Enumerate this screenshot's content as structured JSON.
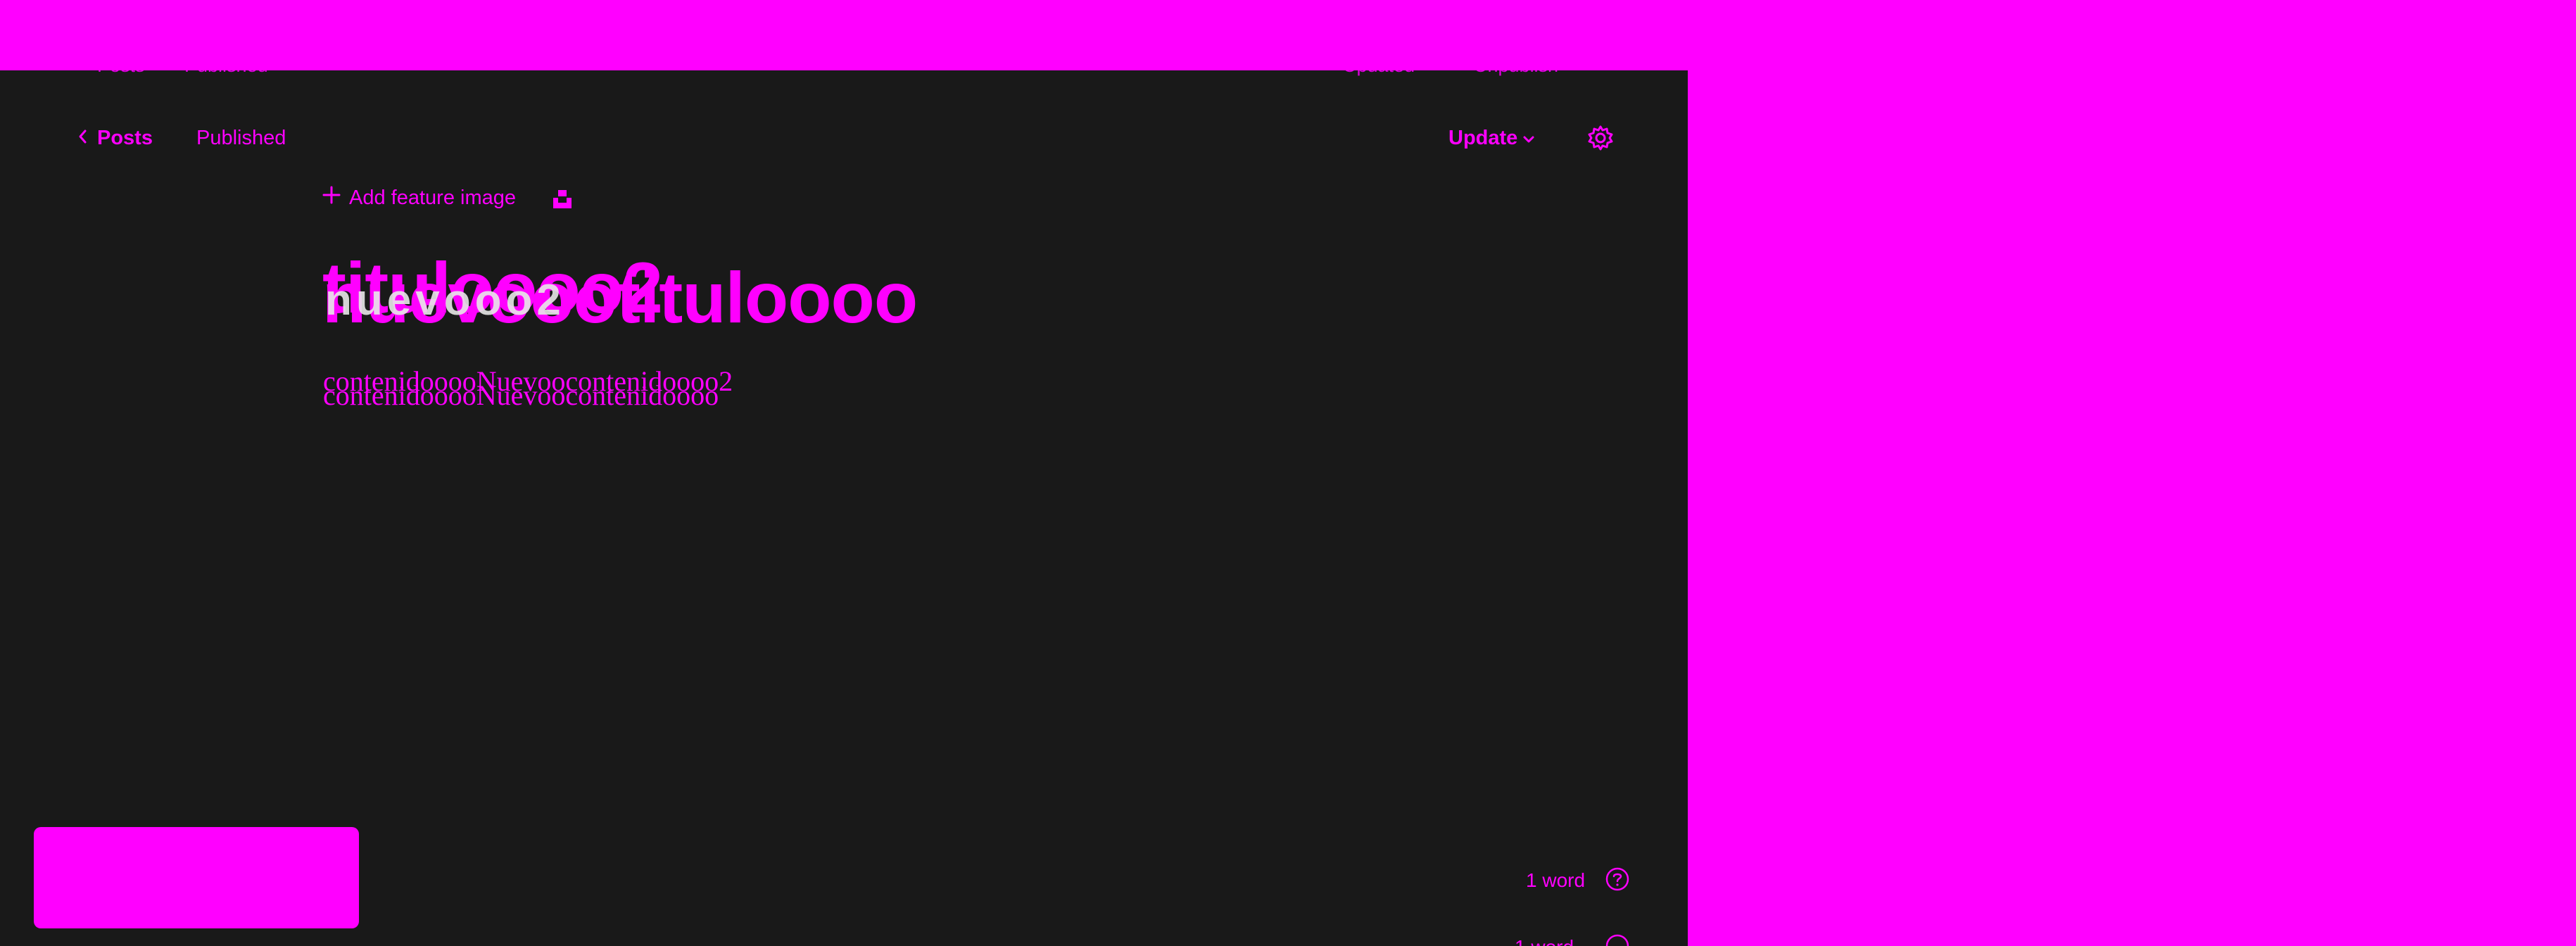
{
  "app": {
    "accent_color": "#ff00ff",
    "background_color": "#191919"
  },
  "ghost_bar": {
    "posts_label": "Posts",
    "published_label": "Published",
    "updated_label": "Updated",
    "unpublish_label": "Unpublish"
  },
  "header": {
    "back_icon": "chevron-left-icon",
    "posts_label": "Posts",
    "status_label": "Published",
    "update_label": "Update",
    "update_icon": "chevron-down-icon",
    "settings_icon": "gear-icon"
  },
  "editor": {
    "add_feature_image_label": "Add feature image",
    "add_icon": "plus-icon",
    "unsplash_icon": "unsplash-icon",
    "title_main": "nuevoootituloooo",
    "title_overlay": "tituloooo2",
    "title_ghost": "nuevooo2",
    "content_line_1": "contenidooooNuevoocontenidoooo2",
    "content_line_2": "contenidooooNuevoocontenidoooo"
  },
  "footer": {
    "word_count": "1 word",
    "help_icon": "question-circle-icon"
  }
}
